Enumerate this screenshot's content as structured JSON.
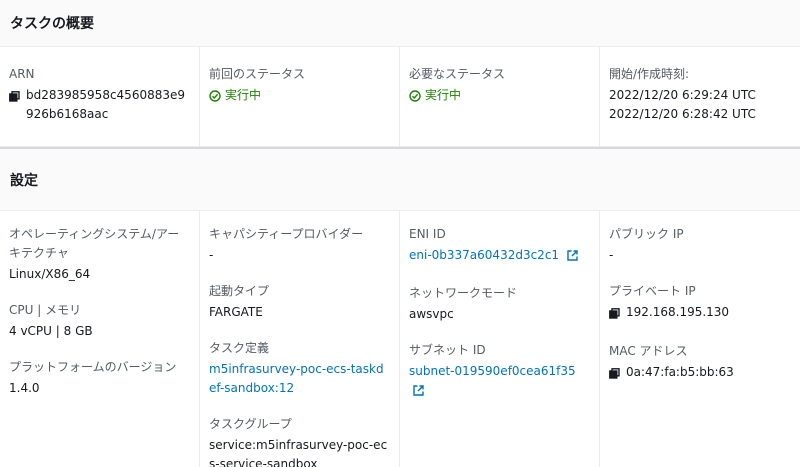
{
  "summary": {
    "title": "タスクの概要",
    "arn": {
      "label": "ARN",
      "value": "bd283985958c4560883e9926b6168aac"
    },
    "last_status": {
      "label": "前回のステータス",
      "value": "実行中"
    },
    "desired_status": {
      "label": "必要なステータス",
      "value": "実行中"
    },
    "started": {
      "label": "開始/作成時刻:",
      "started_at": "2022/12/20 6:29:24 UTC",
      "created_at": "2022/12/20 6:28:42 UTC"
    }
  },
  "settings": {
    "title": "設定",
    "os_arch": {
      "label": "オペレーティングシステム/アーキテクチャ",
      "value": "Linux/X86_64"
    },
    "cpu_memory": {
      "label": "CPU | メモリ",
      "value": "4 vCPU | 8 GB"
    },
    "platform_version": {
      "label": "プラットフォームのバージョン",
      "value": "1.4.0"
    },
    "capacity_provider": {
      "label": "キャパシティープロバイダー",
      "value": "-"
    },
    "launch_type": {
      "label": "起動タイプ",
      "value": "FARGATE"
    },
    "task_definition": {
      "label": "タスク定義",
      "value": "m5infrasurvey-poc-ecs-taskdef-sandbox:12"
    },
    "task_group": {
      "label": "タスクグループ",
      "value": "service:m5infrasurvey-poc-ecs-service-sandbox"
    },
    "eni_id": {
      "label": "ENI ID",
      "value": "eni-0b337a60432d3c2c1"
    },
    "network_mode": {
      "label": "ネットワークモード",
      "value": "awsvpc"
    },
    "subnet_id": {
      "label": "サブネット ID",
      "value": "subnet-019590ef0cea61f35"
    },
    "public_ip": {
      "label": "パブリック IP",
      "value": "-"
    },
    "private_ip": {
      "label": "プライベート IP",
      "value": "192.168.195.130"
    },
    "mac_address": {
      "label": "MAC アドレス",
      "value": "0a:47:fa:b5:bb:63"
    }
  },
  "colors": {
    "link": "#0073bb",
    "success": "#1d8102",
    "label": "#545b64"
  },
  "icons": {
    "copy": "copy-icon",
    "external": "external-link-icon",
    "status": "status-success-icon"
  }
}
